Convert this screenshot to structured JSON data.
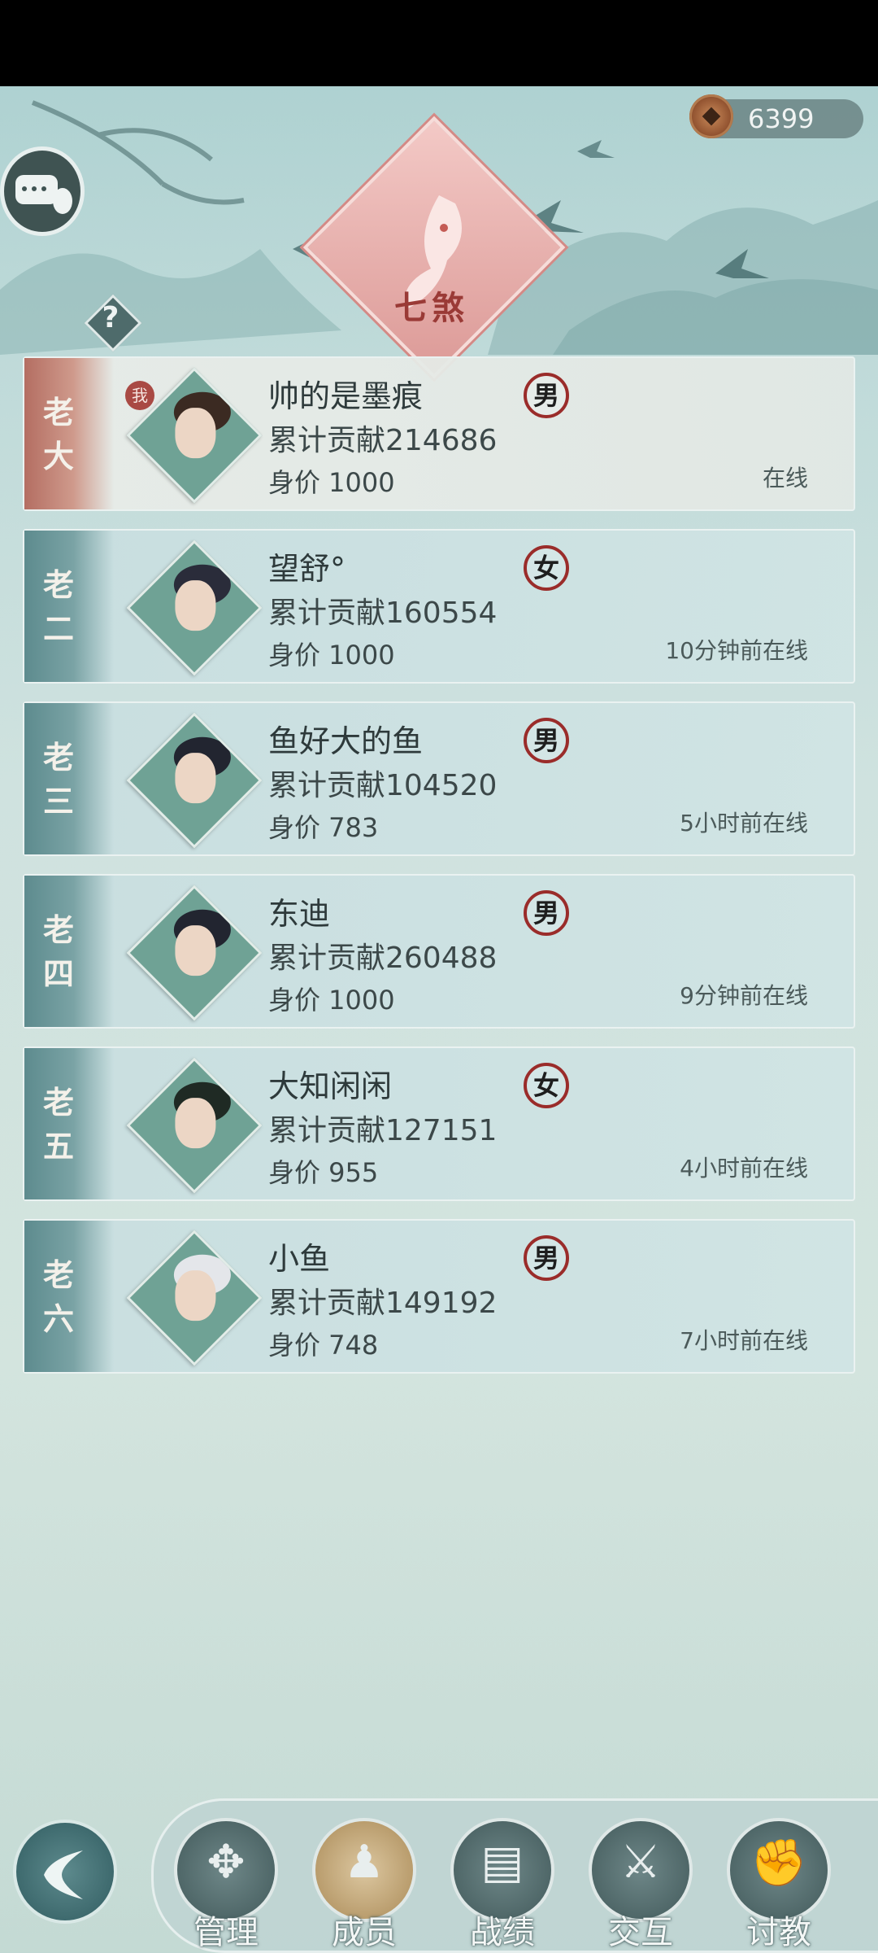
{
  "currency": {
    "value": "6399",
    "icon": "copper-coin-icon"
  },
  "header": {
    "emblem_text": "七煞",
    "help_label": "?"
  },
  "members": [
    {
      "rank": "老大",
      "name": "帅的是墨痕",
      "contribution": "累计贡献214686",
      "worth": "身价 1000",
      "gender": "男",
      "status": "在线",
      "is_me": true,
      "me_badge": "我"
    },
    {
      "rank": "老二",
      "name": "望舒°",
      "contribution": "累计贡献160554",
      "worth": "身价 1000",
      "gender": "女",
      "status": "10分钟前在线",
      "is_me": false
    },
    {
      "rank": "老三",
      "name": "鱼好大的鱼",
      "contribution": "累计贡献104520",
      "worth": "身价 783",
      "gender": "男",
      "status": "5小时前在线",
      "is_me": false
    },
    {
      "rank": "老四",
      "name": "东迪",
      "contribution": "累计贡献260488",
      "worth": "身价 1000",
      "gender": "男",
      "status": "9分钟前在线",
      "is_me": false
    },
    {
      "rank": "老五",
      "name": "大知闲闲",
      "contribution": "累计贡献127151",
      "worth": "身价 955",
      "gender": "女",
      "status": "4小时前在线",
      "is_me": false
    },
    {
      "rank": "老六",
      "name": "小鱼",
      "contribution": "累计贡献149192",
      "worth": "身价 748",
      "gender": "男",
      "status": "7小时前在线",
      "is_me": false
    }
  ],
  "nav": {
    "items": [
      {
        "label": "管理",
        "icon": "management-icon",
        "active": false
      },
      {
        "label": "成员",
        "icon": "members-icon",
        "active": true
      },
      {
        "label": "战绩",
        "icon": "scroll-icon",
        "active": false
      },
      {
        "label": "交互",
        "icon": "interact-icon",
        "active": false
      },
      {
        "label": "讨教",
        "icon": "duel-icon",
        "active": false
      }
    ]
  },
  "colors": {
    "accent_red": "#9a2c2a",
    "teal": "#5d8b8e",
    "gold": "#b79a6a"
  }
}
